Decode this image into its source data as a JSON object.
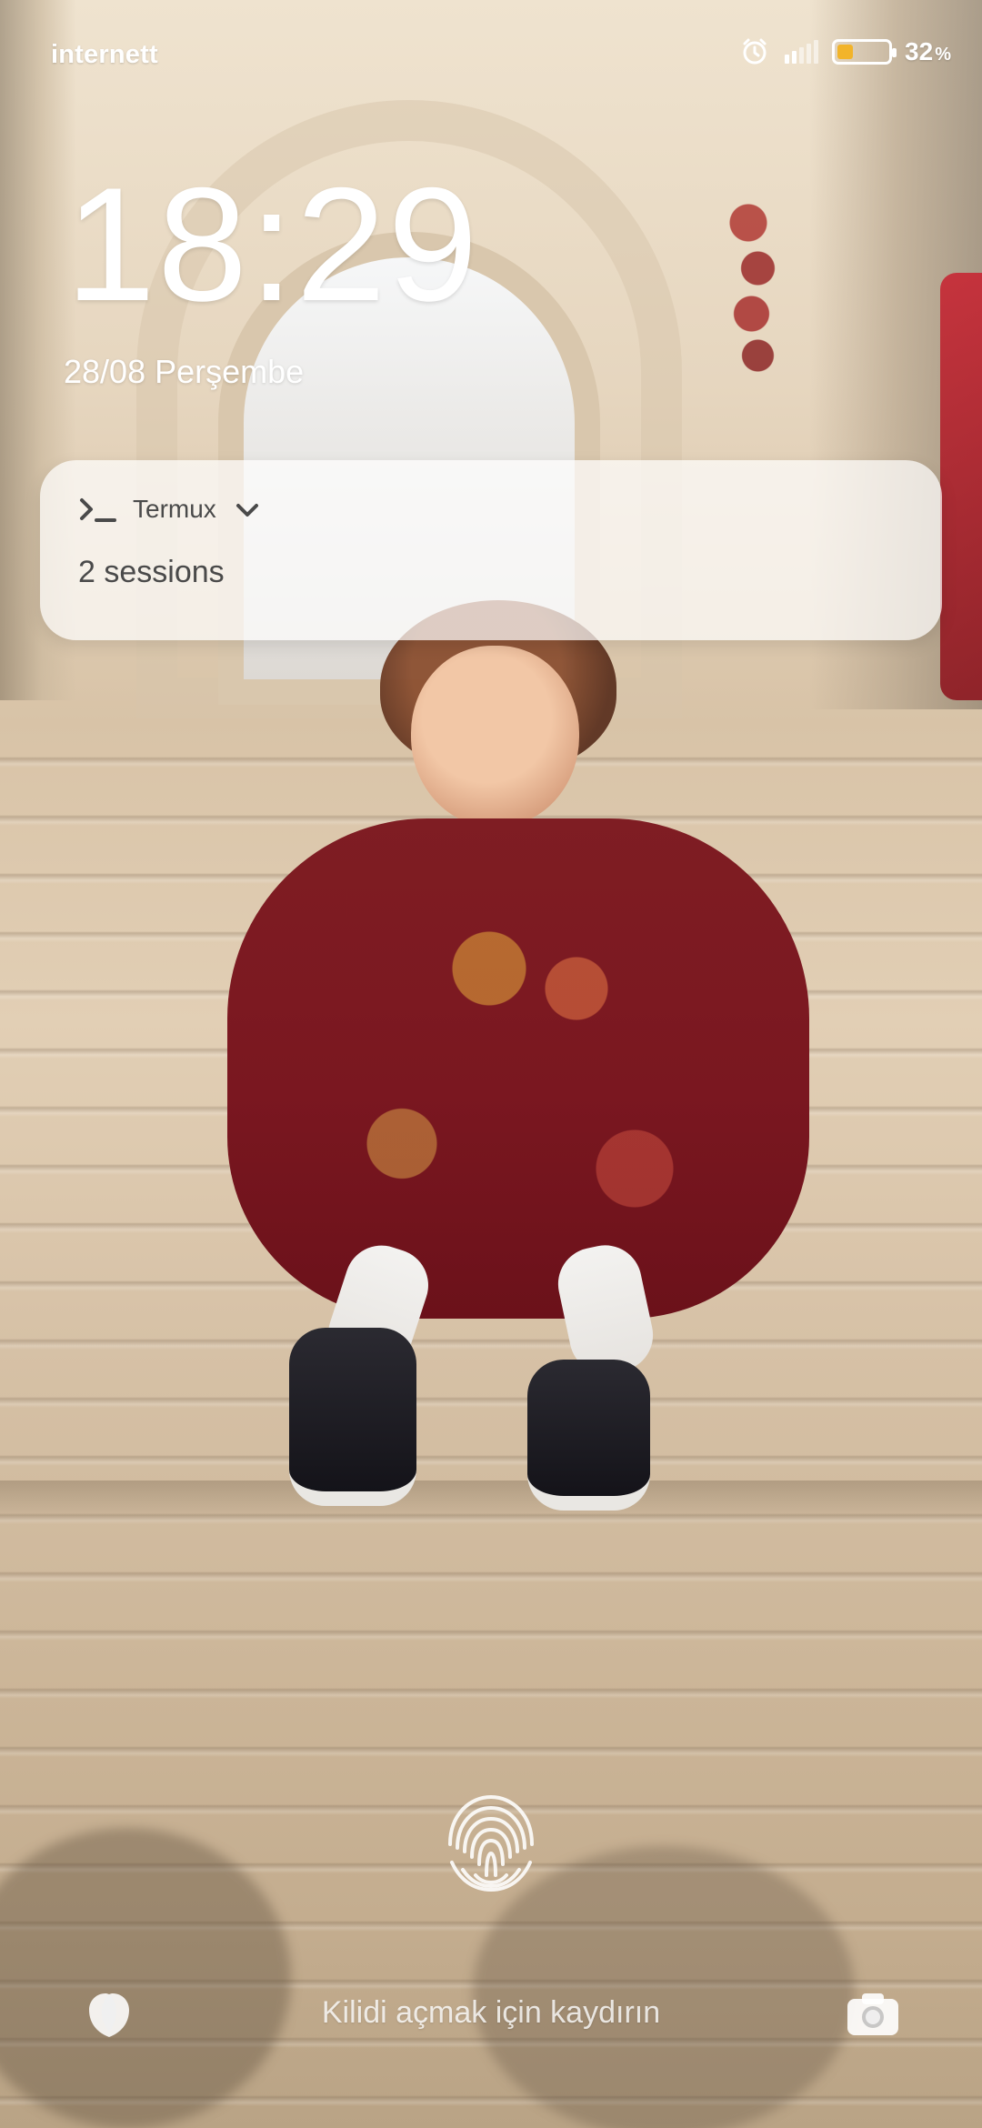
{
  "status_bar": {
    "carrier": "internett",
    "battery_percent_value": 32,
    "battery_percent_text": "32",
    "battery_percent_sign": "%",
    "icons": [
      "alarm-icon",
      "signal-icon",
      "battery-icon"
    ],
    "battery_fill_color": "#f2b42a"
  },
  "lockscreen": {
    "time": "18:29",
    "date": "28/08 Perşembe",
    "unlock_hint": "Kilidi açmak için kaydırın",
    "bottom_icons": [
      "tulip-icon",
      "camera-icon"
    ],
    "center_icon": "fingerprint-icon"
  },
  "notification": {
    "app_icon": "terminal-icon",
    "app_name": "Termux",
    "expand_icon": "chevron-down-icon",
    "text": "2 sessions"
  }
}
